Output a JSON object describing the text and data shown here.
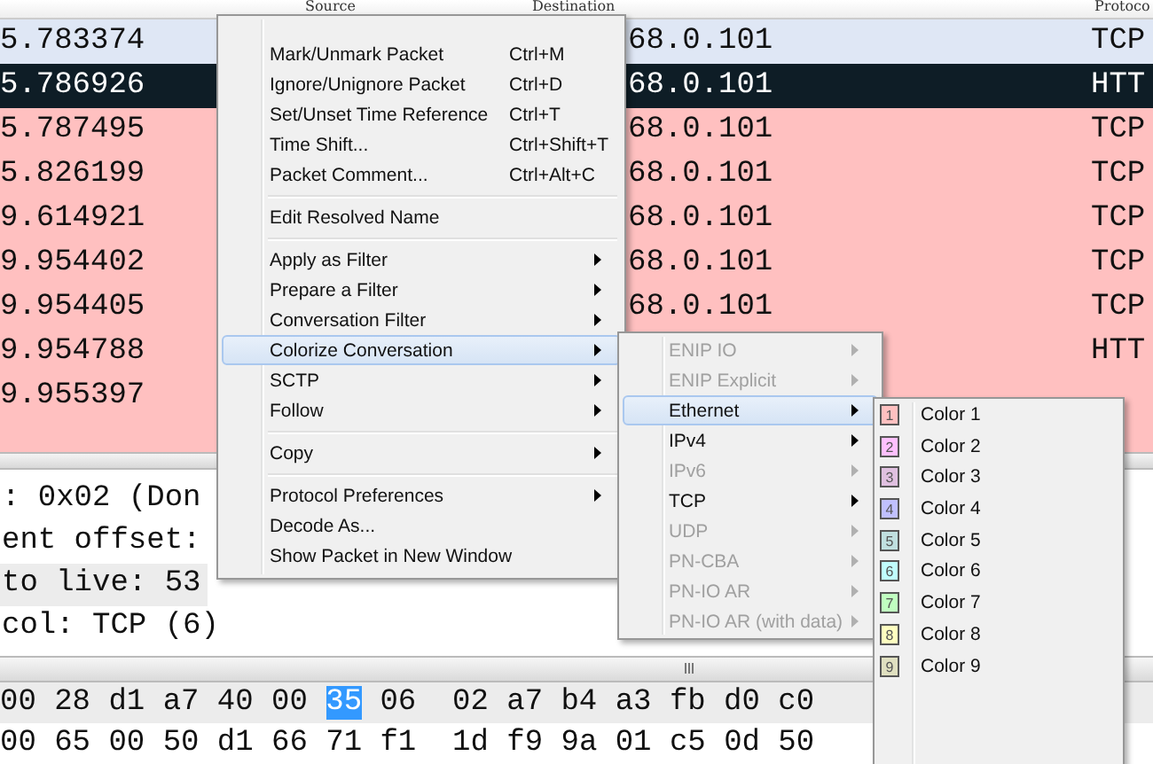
{
  "packet_list": {
    "columns": [
      "Source",
      "Destination",
      "Protoco"
    ],
    "rows": [
      {
        "time": "5.783374",
        "destination": "68.0.101",
        "protocol": "TCP",
        "selected": false,
        "color": "#dfe7f5"
      },
      {
        "time": "5.786926",
        "destination": "68.0.101",
        "protocol": "HTT",
        "selected": true
      },
      {
        "time": "5.787495",
        "destination": "68.0.101",
        "protocol": "TCP",
        "selected": false,
        "color": "#ffc0c0"
      },
      {
        "time": "5.826199",
        "destination": "68.0.101",
        "protocol": "TCP",
        "selected": false,
        "color": "#ffc0c0"
      },
      {
        "time": "9.614921",
        "destination": "68.0.101",
        "protocol": "TCP",
        "selected": false,
        "color": "#ffc0c0"
      },
      {
        "time": "9.954402",
        "destination": "68.0.101",
        "protocol": "TCP",
        "selected": false,
        "color": "#ffc0c0"
      },
      {
        "time": "9.954405",
        "destination": "68.0.101",
        "protocol": "TCP",
        "selected": false,
        "color": "#ffc0c0"
      },
      {
        "time": "9.954788",
        "protocol": "HTT",
        "selected": false,
        "color": "#ffc0c0"
      },
      {
        "time": "9.955397",
        "selected": false,
        "color": "#ffc0c0"
      }
    ]
  },
  "details": [
    {
      "text": ": 0x02 (Don",
      "selected": false
    },
    {
      "text": "ent offset:",
      "selected": false
    },
    {
      "text": "to live: 53",
      "selected": true
    },
    {
      "text": "col: TCP (6)",
      "selected": false
    }
  ],
  "hex": [
    {
      "before": "00 28 d1 a7 40 00",
      "highlight": "35",
      "after": "06  02 a7 b4 a3 fb d0 c0"
    },
    {
      "before": "00 65 00 50 d1 66 71 f1  1d f9 9a 01 c5 0d 50"
    }
  ],
  "context_menu": [
    {
      "kind": "item",
      "label": "Mark/Unmark Packet",
      "shortcut": "Ctrl+M",
      "submenu": false,
      "disabled": false,
      "selected": false
    },
    {
      "kind": "item",
      "label": "Ignore/Unignore Packet",
      "shortcut": "Ctrl+D",
      "submenu": false,
      "disabled": false,
      "selected": false
    },
    {
      "kind": "item",
      "label": "Set/Unset Time Reference",
      "shortcut": "Ctrl+T",
      "submenu": false,
      "disabled": false,
      "selected": false
    },
    {
      "kind": "item",
      "label": "Time Shift...",
      "shortcut": "Ctrl+Shift+T",
      "submenu": false,
      "disabled": false,
      "selected": false
    },
    {
      "kind": "item",
      "label": "Packet Comment...",
      "shortcut": "Ctrl+Alt+C",
      "submenu": false,
      "disabled": false,
      "selected": false
    },
    {
      "kind": "separator"
    },
    {
      "kind": "item",
      "label": "Edit Resolved Name",
      "submenu": false,
      "disabled": false,
      "selected": false
    },
    {
      "kind": "separator"
    },
    {
      "kind": "item",
      "label": "Apply as Filter",
      "submenu": true,
      "disabled": false,
      "selected": false
    },
    {
      "kind": "item",
      "label": "Prepare a Filter",
      "submenu": true,
      "disabled": false,
      "selected": false
    },
    {
      "kind": "item",
      "label": "Conversation Filter",
      "submenu": true,
      "disabled": false,
      "selected": false
    },
    {
      "kind": "item",
      "label": "Colorize Conversation",
      "submenu": true,
      "disabled": false,
      "selected": true
    },
    {
      "kind": "item",
      "label": "SCTP",
      "submenu": true,
      "disabled": false,
      "selected": false
    },
    {
      "kind": "item",
      "label": "Follow",
      "submenu": true,
      "disabled": false,
      "selected": false
    },
    {
      "kind": "separator"
    },
    {
      "kind": "item",
      "label": "Copy",
      "submenu": true,
      "disabled": false,
      "selected": false
    },
    {
      "kind": "separator"
    },
    {
      "kind": "item",
      "label": "Protocol Preferences",
      "submenu": true,
      "disabled": false,
      "selected": false
    },
    {
      "kind": "item",
      "label": "Decode As...",
      "submenu": false,
      "disabled": false,
      "selected": false
    },
    {
      "kind": "item",
      "label": "Show Packet in New Window",
      "submenu": false,
      "disabled": false,
      "selected": false
    }
  ],
  "colorize_menu": [
    {
      "label": "ENIP IO",
      "disabled": true,
      "selected": false
    },
    {
      "label": "ENIP Explicit",
      "disabled": true,
      "selected": false
    },
    {
      "label": "Ethernet",
      "disabled": false,
      "selected": true
    },
    {
      "label": "IPv4",
      "disabled": false,
      "selected": false
    },
    {
      "label": "IPv6",
      "disabled": true,
      "selected": false
    },
    {
      "label": "TCP",
      "disabled": false,
      "selected": false
    },
    {
      "label": "UDP",
      "disabled": true,
      "selected": false
    },
    {
      "label": "PN-CBA",
      "disabled": true,
      "selected": false
    },
    {
      "label": "PN-IO AR",
      "disabled": true,
      "selected": false
    },
    {
      "label": "PN-IO AR (with data)",
      "disabled": true,
      "selected": false
    }
  ],
  "color_menu": [
    {
      "number": "1",
      "label": "Color 1",
      "color": "#ffc0c0"
    },
    {
      "number": "2",
      "label": "Color 2",
      "color": "#ffc0ff"
    },
    {
      "number": "3",
      "label": "Color 3",
      "color": "#e0c0e0"
    },
    {
      "number": "4",
      "label": "Color 4",
      "color": "#c0c0ff"
    },
    {
      "number": "5",
      "label": "Color 5",
      "color": "#c0e0e0"
    },
    {
      "number": "6",
      "label": "Color 6",
      "color": "#c0ffff"
    },
    {
      "number": "7",
      "label": "Color 7",
      "color": "#c0ffc0"
    },
    {
      "number": "8",
      "label": "Color 8",
      "color": "#ffffc0"
    },
    {
      "number": "9",
      "label": "Color 9",
      "color": "#e0e0c0"
    }
  ]
}
